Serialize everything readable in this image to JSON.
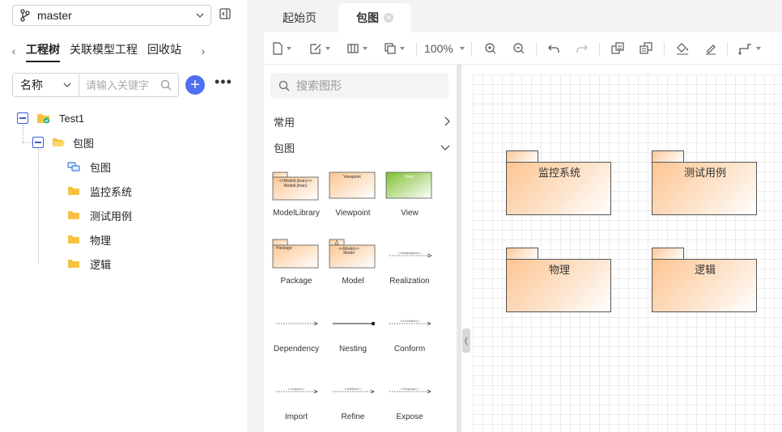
{
  "branch": {
    "name": "master"
  },
  "nav_tabs": [
    "工程树",
    "关联模型工程",
    "回收站"
  ],
  "search": {
    "filter_value": "名称",
    "placeholder": "请输入关键字"
  },
  "tree": {
    "root": "Test1",
    "folder": "包图",
    "diagram": "包图",
    "children": [
      "监控系统",
      "测试用例",
      "物理",
      "逻辑"
    ]
  },
  "editor_tabs": [
    {
      "label": "起始页",
      "active": false
    },
    {
      "label": "包图",
      "active": true
    }
  ],
  "toolbar": {
    "zoom": "100%"
  },
  "palette": {
    "search_placeholder": "搜索图形",
    "sections": [
      "常用",
      "包图"
    ],
    "shapes": [
      {
        "label": "ModelLibrary",
        "inner": "<<ModelLibrary>> ModelLibrary"
      },
      {
        "label": "Viewpoint",
        "inner": "Viewpoint"
      },
      {
        "label": "View",
        "inner": "View"
      },
      {
        "label": "Package",
        "inner": "Package"
      },
      {
        "label": "Model",
        "inner": "<<Model>> Model"
      },
      {
        "label": "Realization",
        "inner": "<<Realization>>"
      },
      {
        "label": "Dependency",
        "inner": ""
      },
      {
        "label": "Nesting",
        "inner": ""
      },
      {
        "label": "Conform",
        "inner": "<<Conform>>"
      },
      {
        "label": "Import",
        "inner": "<<Import>>"
      },
      {
        "label": "Refine",
        "inner": "<<Refine>>"
      },
      {
        "label": "Expose",
        "inner": "<<Expose>>"
      }
    ]
  },
  "canvas": {
    "packages": [
      "监控系统",
      "测试用例",
      "物理",
      "逻辑"
    ]
  },
  "colors": {
    "accent": "#4d6ff0",
    "package_fill": "#fdc592",
    "view_fill": "#8cc63f"
  }
}
